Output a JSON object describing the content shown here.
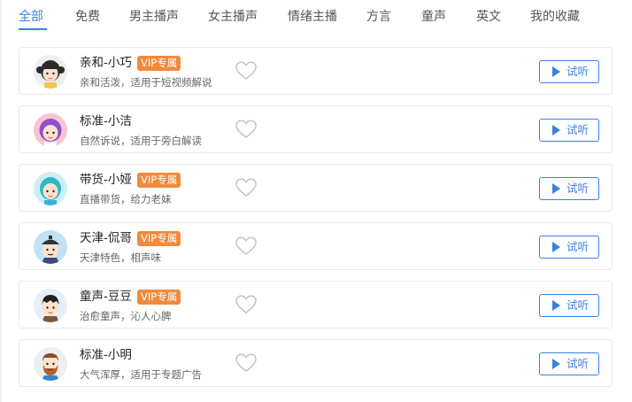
{
  "tabs": [
    {
      "label": "全部",
      "active": true
    },
    {
      "label": "免费",
      "active": false
    },
    {
      "label": "男主播声",
      "active": false
    },
    {
      "label": "女主播声",
      "active": false
    },
    {
      "label": "情绪主播",
      "active": false
    },
    {
      "label": "方言",
      "active": false
    },
    {
      "label": "童声",
      "active": false
    },
    {
      "label": "英文",
      "active": false
    },
    {
      "label": "我的收藏",
      "active": false
    }
  ],
  "accent_color": "#3a80e0",
  "vip_color": "#f08a3c",
  "voices": [
    {
      "name": "亲和-小巧",
      "vip": "VIP专属",
      "desc": "亲和活泼，适用于短视频解说",
      "listen": "试听",
      "avatar_icon": "girl-braids-avatar-icon",
      "favorite_icon": "heart-outline-icon",
      "favorited": false
    },
    {
      "name": "标准-小洁",
      "vip": "",
      "desc": "自然诉说，适用于旁白解读",
      "listen": "试听",
      "avatar_icon": "girl-purple-hair-avatar-icon",
      "favorite_icon": "heart-outline-icon",
      "favorited": false
    },
    {
      "name": "带货-小娅",
      "vip": "VIP专属",
      "desc": "直播带货，给力老妹",
      "listen": "试听",
      "avatar_icon": "girl-teal-hair-avatar-icon",
      "favorite_icon": "heart-outline-icon",
      "favorited": false
    },
    {
      "name": "天津-侃哥",
      "vip": "VIP专属",
      "desc": "天津特色，相声味",
      "listen": "试听",
      "avatar_icon": "man-traditional-hat-avatar-icon",
      "favorite_icon": "heart-outline-icon",
      "favorited": false
    },
    {
      "name": "童声-豆豆",
      "vip": "VIP专属",
      "desc": "治愈童声，沁人心脾",
      "listen": "试听",
      "avatar_icon": "boy-avatar-icon",
      "favorite_icon": "heart-outline-icon",
      "favorited": false
    },
    {
      "name": "标准-小明",
      "vip": "",
      "desc": "大气浑厚，适用于专题广告",
      "listen": "试听",
      "avatar_icon": "bearded-man-avatar-icon",
      "favorite_icon": "heart-outline-icon",
      "favorited": false
    }
  ]
}
